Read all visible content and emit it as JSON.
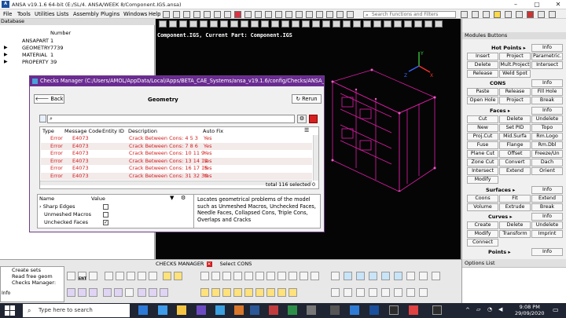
{
  "window": {
    "title": "ANSA v19.1.6 64-bit (E:/SL/4. ANSA/WEEK 8/Component.IGS.ansa)"
  },
  "menu": [
    "File",
    "Tools",
    "Utilities",
    "Lists",
    "Assembly",
    "Plugins",
    "Windows",
    "Help"
  ],
  "search": {
    "placeholder": "Search Functions and Filters"
  },
  "database": {
    "title": "Database",
    "col_number": "Number",
    "rows": [
      {
        "name": "ANSAPART",
        "number": "1"
      },
      {
        "name": "GEOMETRY",
        "number": "7739"
      },
      {
        "name": "MATERIAL",
        "number": "1"
      },
      {
        "name": "PROPERTY",
        "number": "39"
      }
    ]
  },
  "viewport": {
    "info": "Component.IGS, Current Part: Component.IGS"
  },
  "modules": {
    "title": "Modules Buttons",
    "hot_points": {
      "label": "Hot Points",
      "info": "Info",
      "buttons": [
        "Insert",
        "Project",
        "Parametric.",
        "Delete",
        "Mult.Project",
        "Intersect",
        "Release",
        "Weld Spot"
      ]
    },
    "cons": {
      "label": "CONS",
      "info": "Info",
      "buttons": [
        "Paste",
        "Release",
        "Fill Hole",
        "Open Hole",
        "Project",
        "Break"
      ]
    },
    "faces": {
      "label": "Faces",
      "info": "Info",
      "buttons": [
        "Cut",
        "Delete",
        "Undelete",
        "New",
        "Set PID",
        "Topo",
        "Proj.Cut",
        "Mid.Surfa",
        "Rm.Logo",
        "Fuse",
        "Flange",
        "Rm.Dbl",
        "Plane Cut",
        "Offset",
        "Freeze/Un",
        "Zone Cut",
        "Convert",
        "Dach",
        "Intersect",
        "Extend",
        "Orient",
        "Modify"
      ]
    },
    "surfaces": {
      "label": "Surfaces",
      "info": "Info",
      "buttons": [
        "Coons",
        "Fit",
        "Extend",
        "Volume",
        "Extrude",
        "Break"
      ]
    },
    "curves": {
      "label": "Curves",
      "info": "Info",
      "buttons": [
        "Create",
        "Delete",
        "Undelete",
        "Modify",
        "Transform",
        "Imprint",
        "Connect"
      ]
    },
    "points": {
      "label": "Points",
      "info": "Info"
    }
  },
  "checks_manager": {
    "title": "Checks Manager (C:/Users/AMOL/AppData/Local/Apps/BETA_CAE_Systems/ansa_v19.1.6/config/Checks/ANSA_Templates...",
    "back": "Back",
    "heading": "Geometry",
    "rerun": "Rerun",
    "columns": [
      "Type",
      "Message Code",
      "Entity",
      "ID",
      "Description",
      "Auto Fix"
    ],
    "rows": [
      {
        "type": "Error",
        "code": "E4073",
        "desc": "Crack Between Cons: 4 5 3",
        "fix": "Yes"
      },
      {
        "type": "Error",
        "code": "E4073",
        "desc": "Crack Between Cons: 7 8 6",
        "fix": "Yes"
      },
      {
        "type": "Error",
        "code": "E4073",
        "desc": "Crack Between Cons: 10 11 9",
        "fix": "Yes"
      },
      {
        "type": "Error",
        "code": "E4073",
        "desc": "Crack Between Cons: 13 14 12",
        "fix": "Yes"
      },
      {
        "type": "Error",
        "code": "E4073",
        "desc": "Crack Between Cons: 16 17 15",
        "fix": "Yes"
      },
      {
        "type": "Error",
        "code": "E4073",
        "desc": "Crack Between Cons: 31 32 30",
        "fix": "Yes"
      }
    ],
    "footer": "total 116 selected 0",
    "props_columns": [
      "Name",
      "Value"
    ],
    "props": [
      {
        "name": "Sharp Edges",
        "checked": false
      },
      {
        "name": "Unmeshed Macros",
        "checked": false
      },
      {
        "name": "Unchecked Faces",
        "checked": true
      }
    ],
    "description": "Locates geometrical problems of the model such as Unmeshed Macros, Unchecked Faces, Needle Faces, Collapsed Cons, Triple Cons, Overlaps and Cracks"
  },
  "bottom": {
    "tab1": "CHECKS MANAGER",
    "tab2": "Select CONS",
    "info_lines": [
      "Create sets",
      "Read free geom",
      "Checks Manager:"
    ],
    "info_label": "Info",
    "ent_label": "ENT"
  },
  "options_list": {
    "title": "Options List"
  },
  "taskbar": {
    "search": "Type here to search",
    "time": "9:08 PM",
    "date": "29/09/2020"
  },
  "colors": {
    "dialog_title": "#6a2c91",
    "error_text": "#d21c1c",
    "viewport_bg": "#050505"
  }
}
